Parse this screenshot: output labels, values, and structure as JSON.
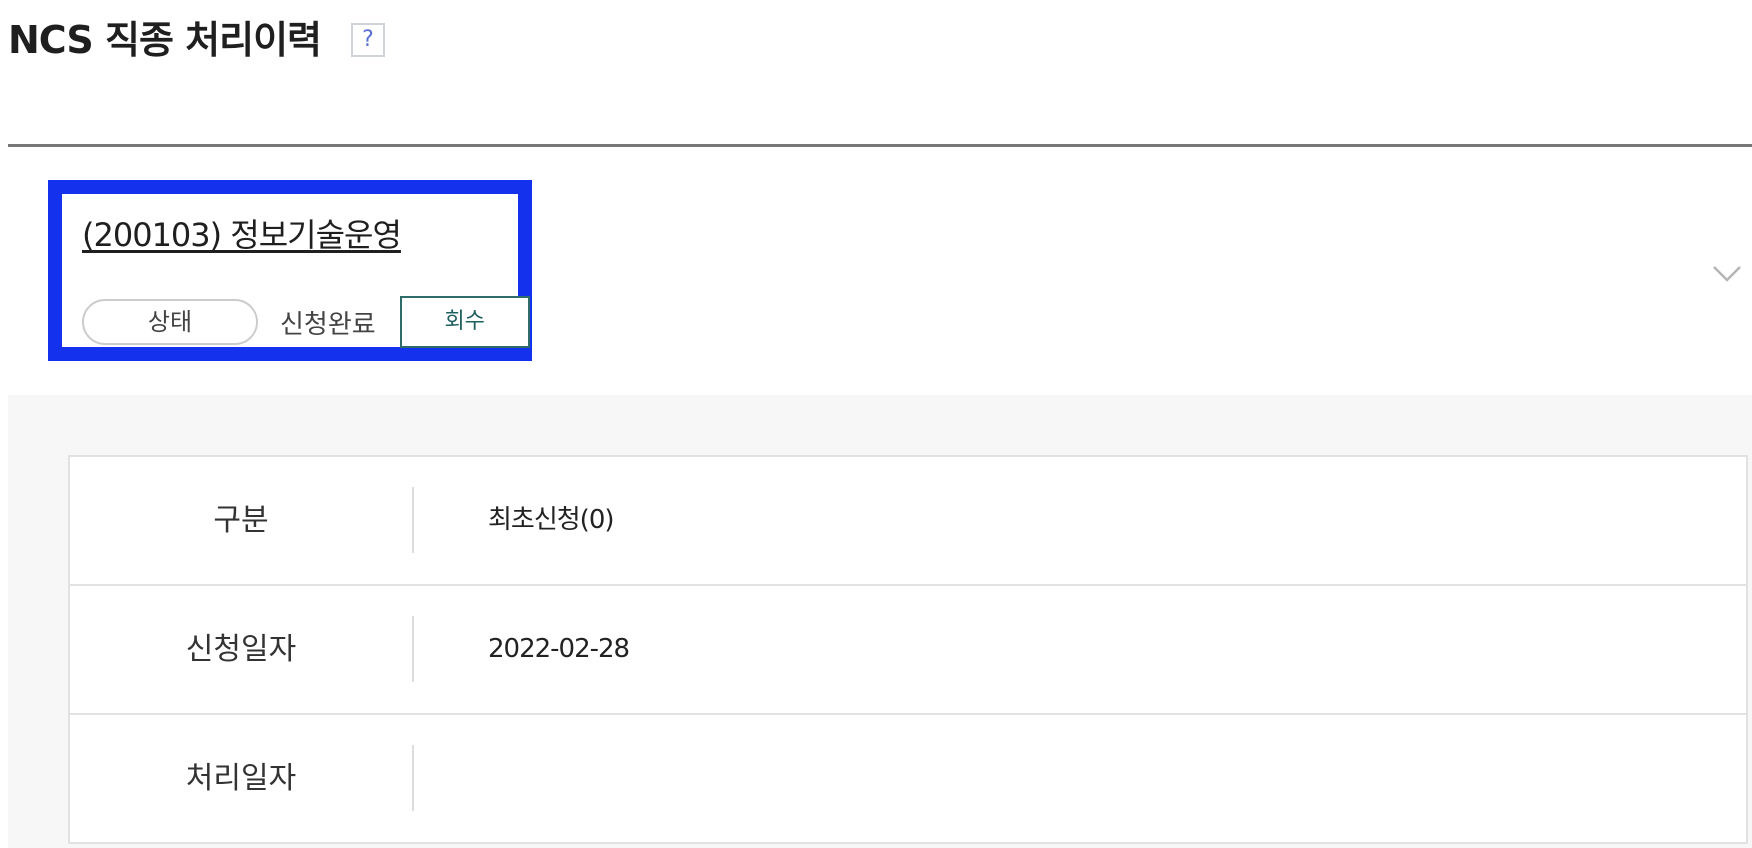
{
  "header": {
    "title": "NCS 직종 처리이력",
    "help_label": "?"
  },
  "job": {
    "link": "(200103) 정보기술운영",
    "status_label": "상태",
    "status_value": "신청완료",
    "withdraw_label": "회수"
  },
  "details": {
    "rows": [
      {
        "label": "구분",
        "value": "최초신청(0)"
      },
      {
        "label": "신청일자",
        "value": "2022-02-28"
      },
      {
        "label": "처리일자",
        "value": ""
      }
    ]
  },
  "colors": {
    "card_highlight": "#1432ee",
    "withdraw_border": "#2e6b6b",
    "help_accent": "#5a6fd6"
  }
}
